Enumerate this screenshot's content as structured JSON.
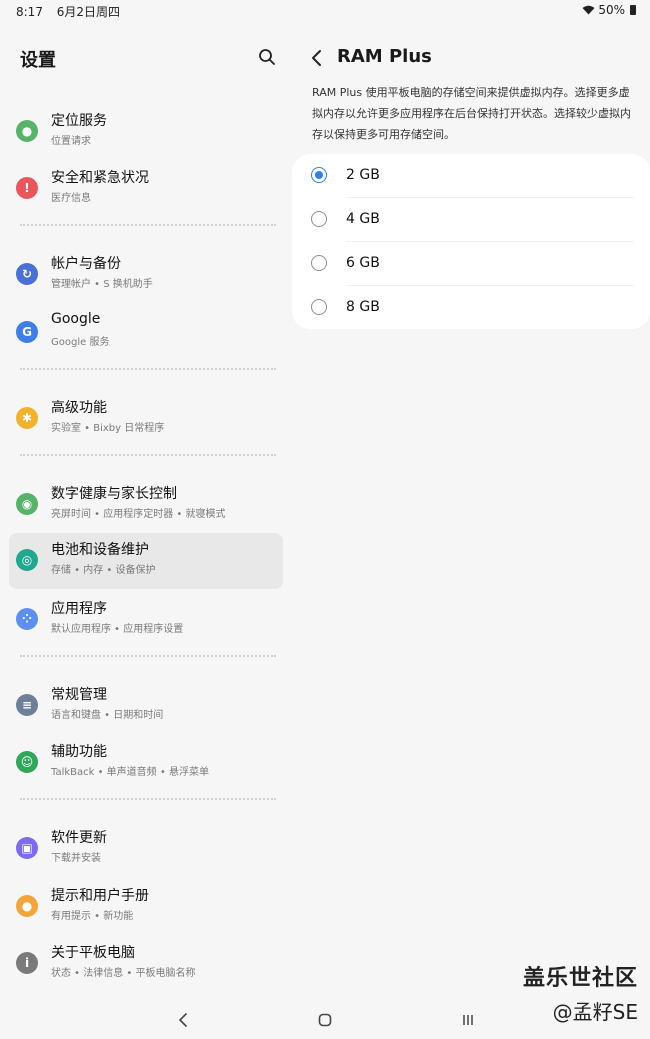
{
  "status": {
    "time": "8:17",
    "date": "6月2日周四",
    "battery": "50%"
  },
  "settings": {
    "title": "设置",
    "items": [
      {
        "title": "定位服务",
        "sub": "位置请求",
        "icon": "location-icon",
        "color": "#57b36a"
      },
      {
        "title": "安全和紧急状况",
        "sub": "医疗信息",
        "icon": "emergency-icon",
        "color": "#e8565b"
      },
      {
        "title": "帐户与备份",
        "sub": "管理帐户 • S 换机助手",
        "icon": "sync-icon",
        "color": "#4a6fd6"
      },
      {
        "title": "Google",
        "sub": "Google 服务",
        "icon": "google-icon",
        "color": "#3f7de8"
      },
      {
        "title": "高级功能",
        "sub": "实验室 • Bixby 日常程序",
        "icon": "gear-plus-icon",
        "color": "#f2b22b"
      },
      {
        "title": "数字健康与家长控制",
        "sub": "亮屏时间 • 应用程序定时器 • 就寝模式",
        "icon": "wellbeing-icon",
        "color": "#57b36a"
      },
      {
        "title": "电池和设备维护",
        "sub": "存储 • 内存 • 设备保护",
        "icon": "device-care-icon",
        "color": "#1fa88f"
      },
      {
        "title": "应用程序",
        "sub": "默认应用程序 • 应用程序设置",
        "icon": "apps-icon",
        "color": "#5b8ff0"
      },
      {
        "title": "常规管理",
        "sub": "语言和键盘 • 日期和时间",
        "icon": "sliders-icon",
        "color": "#6d7f99"
      },
      {
        "title": "辅助功能",
        "sub": "TalkBack • 单声道音频 • 悬浮菜单",
        "icon": "accessibility-icon",
        "color": "#2fa65a"
      },
      {
        "title": "软件更新",
        "sub": "下载并安装",
        "icon": "update-icon",
        "color": "#7b6cf0"
      },
      {
        "title": "提示和用户手册",
        "sub": "有用提示 • 新功能",
        "icon": "bulb-icon",
        "color": "#f3a53a"
      },
      {
        "title": "关于平板电脑",
        "sub": "状态 • 法律信息 • 平板电脑名称",
        "icon": "info-icon",
        "color": "#7a7a7a"
      }
    ]
  },
  "ramplus": {
    "title": "RAM Plus",
    "description": "RAM Plus 使用平板电脑的存储空间来提供虚拟内存。选择更多虚拟内存以允许更多应用程序在后台保持打开状态。选择较少虚拟内存以保持更多可用存储空间。",
    "options": [
      {
        "label": "2 GB",
        "checked": true
      },
      {
        "label": "4 GB",
        "checked": false
      },
      {
        "label": "6 GB",
        "checked": false
      },
      {
        "label": "8 GB",
        "checked": false
      }
    ]
  },
  "watermark": {
    "line1": "盖乐世社区",
    "line2": "@孟籽SE"
  }
}
